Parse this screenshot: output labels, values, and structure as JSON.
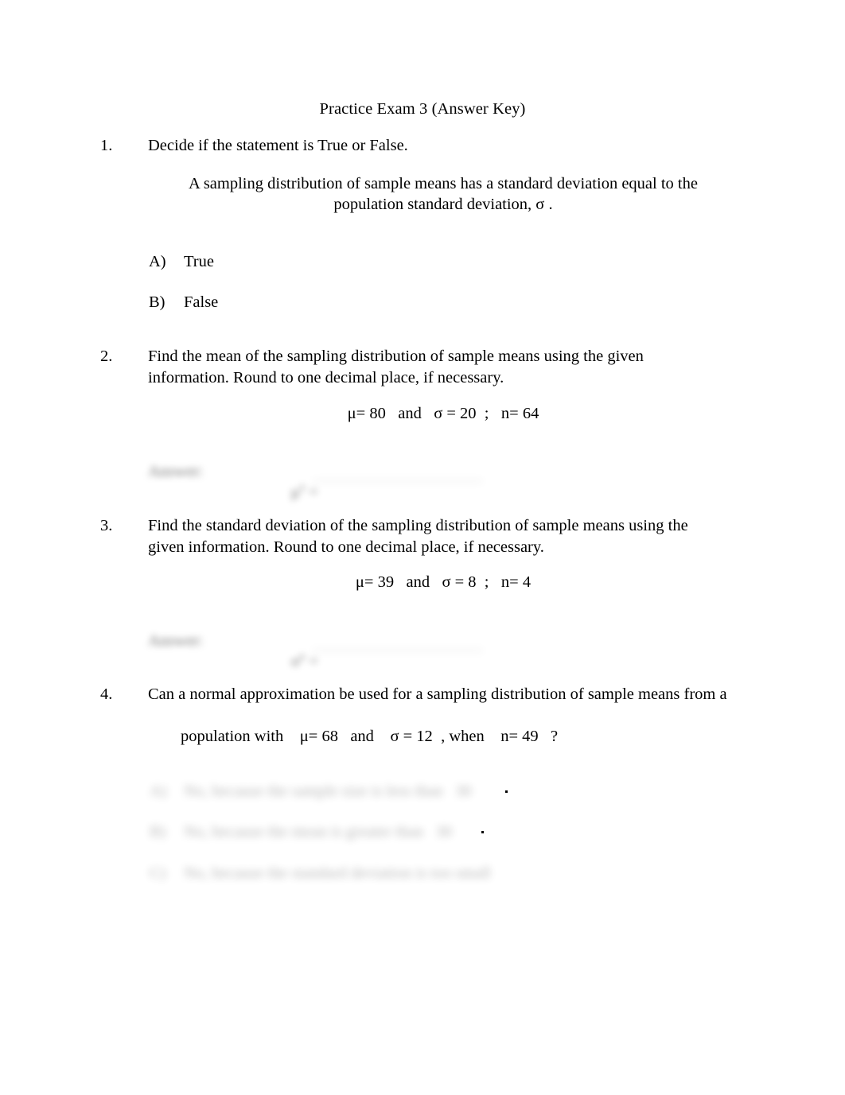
{
  "document": {
    "title": "Practice Exam 3 (Answer Key)",
    "page_background": "#ffffff",
    "text_color": "#000000"
  },
  "questions": [
    {
      "number": "1.",
      "prompt": "Decide if the statement is True or False.",
      "statement_line_1": "A sampling distribution of sample means has a standard deviation equal to the",
      "statement_line_2": "population standard deviation,     σ   .",
      "choices": [
        {
          "letter": "A)",
          "text": "True"
        },
        {
          "letter": "B)",
          "text": "False"
        }
      ]
    },
    {
      "number": "2.",
      "prompt_line_1": "Find the mean of the sampling distribution of sample means using the given",
      "prompt_line_2": "information. Round to one decimal place, if necessary.",
      "given": "μ= 80   and   σ = 20  ;   n= 64",
      "answer": {
        "label": "Answer:",
        "symbol": "μ",
        "symbol_sub": "x̄",
        "symbol_eq": " =",
        "value": "_____________________",
        "redacted": true
      }
    },
    {
      "number": "3.",
      "prompt_line_1": "Find the standard deviation of the sampling distribution of sample means using the",
      "prompt_line_2": "given information. Round to one decimal place, if necessary.",
      "given": "μ= 39   and   σ = 8  ;   n= 4",
      "answer": {
        "label": "Answer:",
        "symbol": "σ",
        "symbol_sub": "x̄",
        "symbol_eq": " =",
        "value": "_____________________",
        "redacted": true
      }
    },
    {
      "number": "4.",
      "prompt_line_1": "Can a normal approximation be used for a sampling distribution of sample means from a",
      "prompt_line_2_pre": "population with    ",
      "prompt_line_2_mu": "μ= 68",
      "prompt_line_2_and": "   and    ",
      "prompt_line_2_sigma": "σ = 12",
      "prompt_line_2_when": "  , when    ",
      "prompt_line_2_n": "n= 49",
      "prompt_line_2_end": "   ?",
      "choices": [
        {
          "letter": "A)",
          "text": "No, because the sample size is less than   30",
          "trailing": ".",
          "redacted": true
        },
        {
          "letter": "B)",
          "text": "No, because the mean is greater than   30",
          "trailing": ".",
          "redacted": true
        },
        {
          "letter": "C)",
          "text": "No, because the standard deviation is too small",
          "trailing": "",
          "redacted": true
        }
      ]
    }
  ]
}
